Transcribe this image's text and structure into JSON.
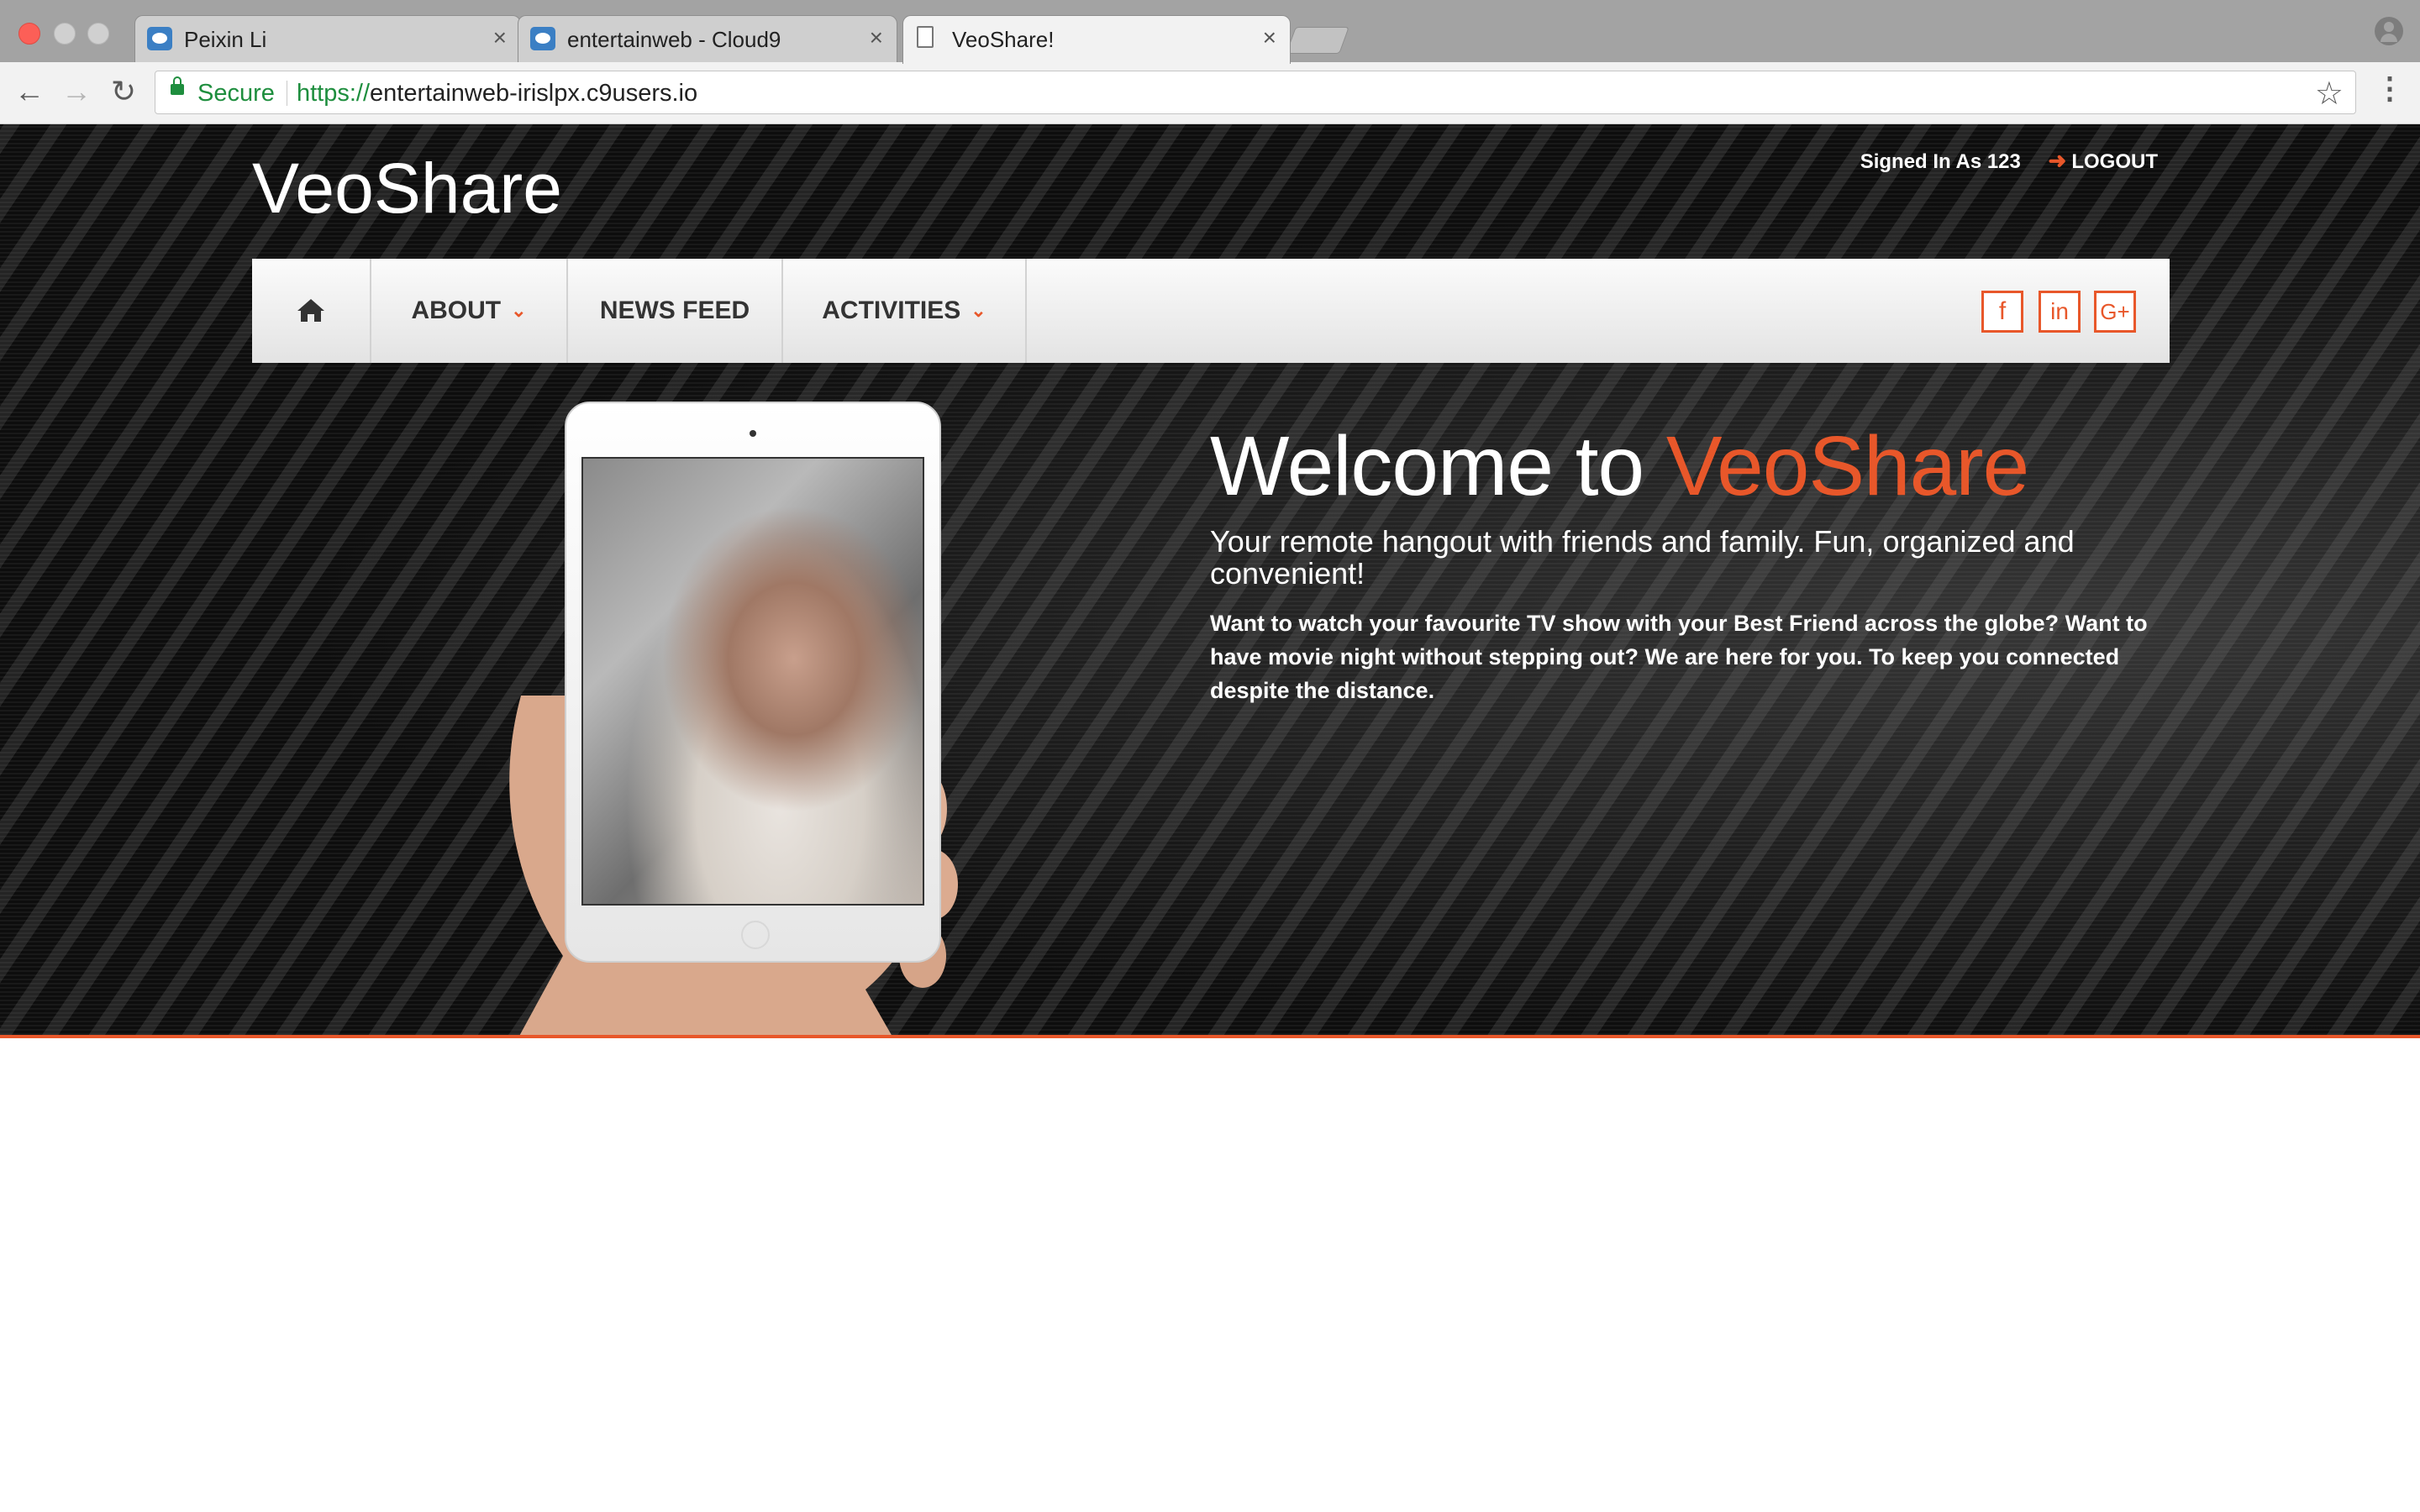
{
  "browser": {
    "tabs": [
      {
        "title": "Peixin Li",
        "close": "×",
        "icon": "cloud9-icon"
      },
      {
        "title": "entertainweb - Cloud9",
        "close": "×",
        "icon": "cloud9-icon"
      },
      {
        "title": "VeoShare!",
        "close": "×",
        "icon": "page-icon"
      }
    ],
    "secure_label": "Secure",
    "url_scheme": "https://",
    "url_host": "entertainweb-irislpx.c9users.io"
  },
  "site": {
    "brand": "VeoShare",
    "signed_in": "Signed In As 123",
    "logout": "LOGOUT",
    "nav": [
      {
        "label": "ABOUT",
        "has_caret": true
      },
      {
        "label": "NEWS FEED",
        "has_caret": false
      },
      {
        "label": "ACTIVITIES",
        "has_caret": true
      }
    ],
    "social": [
      {
        "label": "f",
        "icon": "facebook-icon"
      },
      {
        "label": "in",
        "icon": "linkedin-icon"
      },
      {
        "label": "G+",
        "icon": "google-plus-icon"
      }
    ],
    "caret": "⌄",
    "hero": {
      "welcome_prefix": "Welcome to",
      "welcome_brand": "VeoShare",
      "tagline": "Your remote hangout with friends and family. Fun, organized and convenient!",
      "blurb": "Want to watch your favourite TV show with your Best Friend across the globe? Want to have movie night without stepping out? We are here for you. To keep you connected despite the distance."
    }
  },
  "colors": {
    "accent": "#e8572a",
    "secure": "#1e8e3e"
  }
}
